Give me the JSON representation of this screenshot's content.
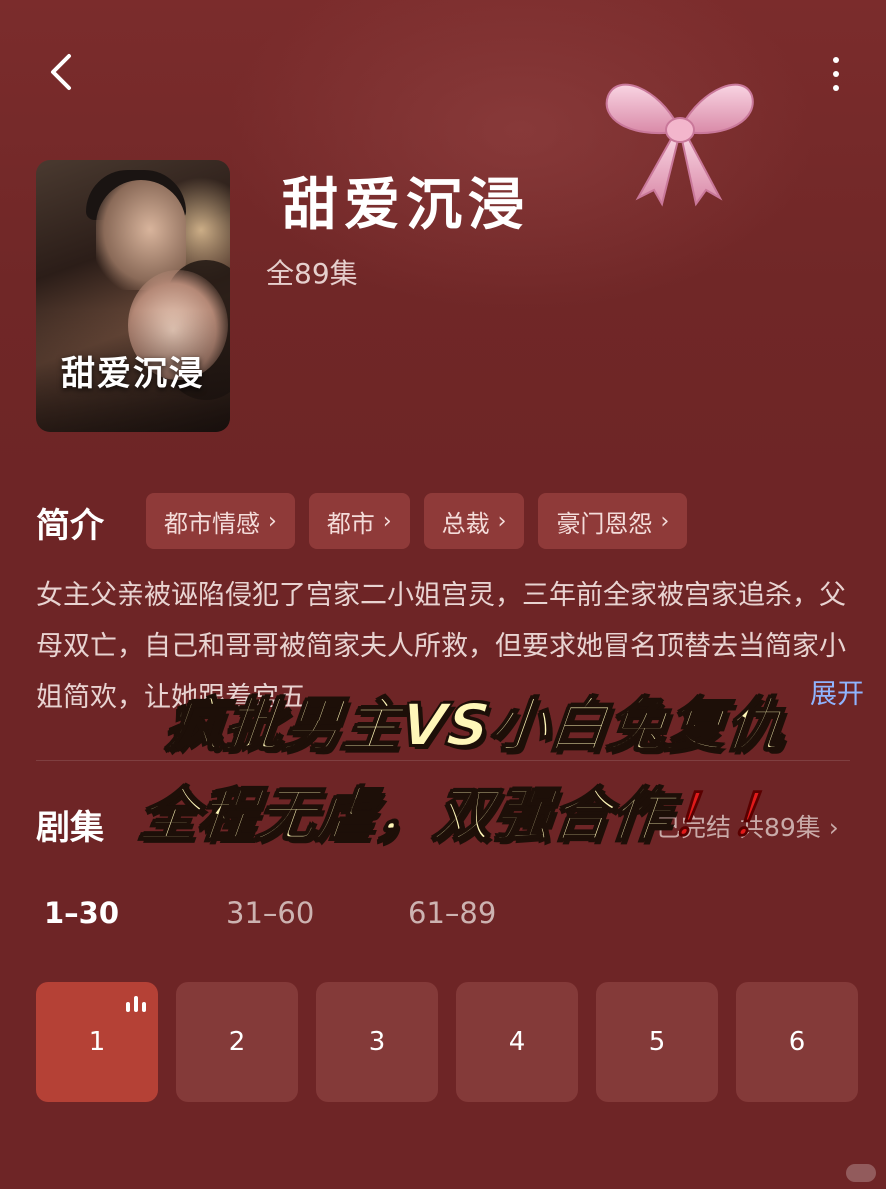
{
  "header": {
    "back_icon": "chevron-left-icon",
    "more_icon": "vertical-ellipsis-icon",
    "decoration_icon": "pink-bow-icon"
  },
  "drama": {
    "poster_title": "甜爱沉浸",
    "title": "甜爱沉浸",
    "episode_total": "全89集"
  },
  "intro": {
    "label": "简介",
    "tags": [
      {
        "label": "都市情感",
        "chevron": "›"
      },
      {
        "label": "都市",
        "chevron": "›"
      },
      {
        "label": "总裁",
        "chevron": "›"
      },
      {
        "label": "豪门恩怨",
        "chevron": "›"
      }
    ],
    "synopsis": "女主父亲被诬陷侵犯了宫家二小姐宫灵，三年前全家被宫家追杀，父母双亡，自己和哥哥被简家夫人所救，但要求她冒名顶替去当简家小姐简欢，让她跟着宫五",
    "expand_label": "展开"
  },
  "episodes": {
    "label": "剧集",
    "status": "已完结 共89集 ›",
    "range_tabs": [
      "1–30",
      "31–60",
      "61–89"
    ],
    "active_range": 0,
    "buttons": [
      "1",
      "2",
      "3",
      "4",
      "5",
      "6"
    ],
    "active_episode": 1
  },
  "overlay": {
    "line1": "疯批男主VS小白兔复仇",
    "line2": "全程无虐，双强合作",
    "line2_bang": "！！"
  },
  "colors": {
    "background": "#6e2526",
    "tag_background": "#8f3a39",
    "episode_button": "#843a39",
    "episode_active": "#b54136",
    "overlay_text": "#fff7b8",
    "expand_link": "#8fb4ff"
  }
}
